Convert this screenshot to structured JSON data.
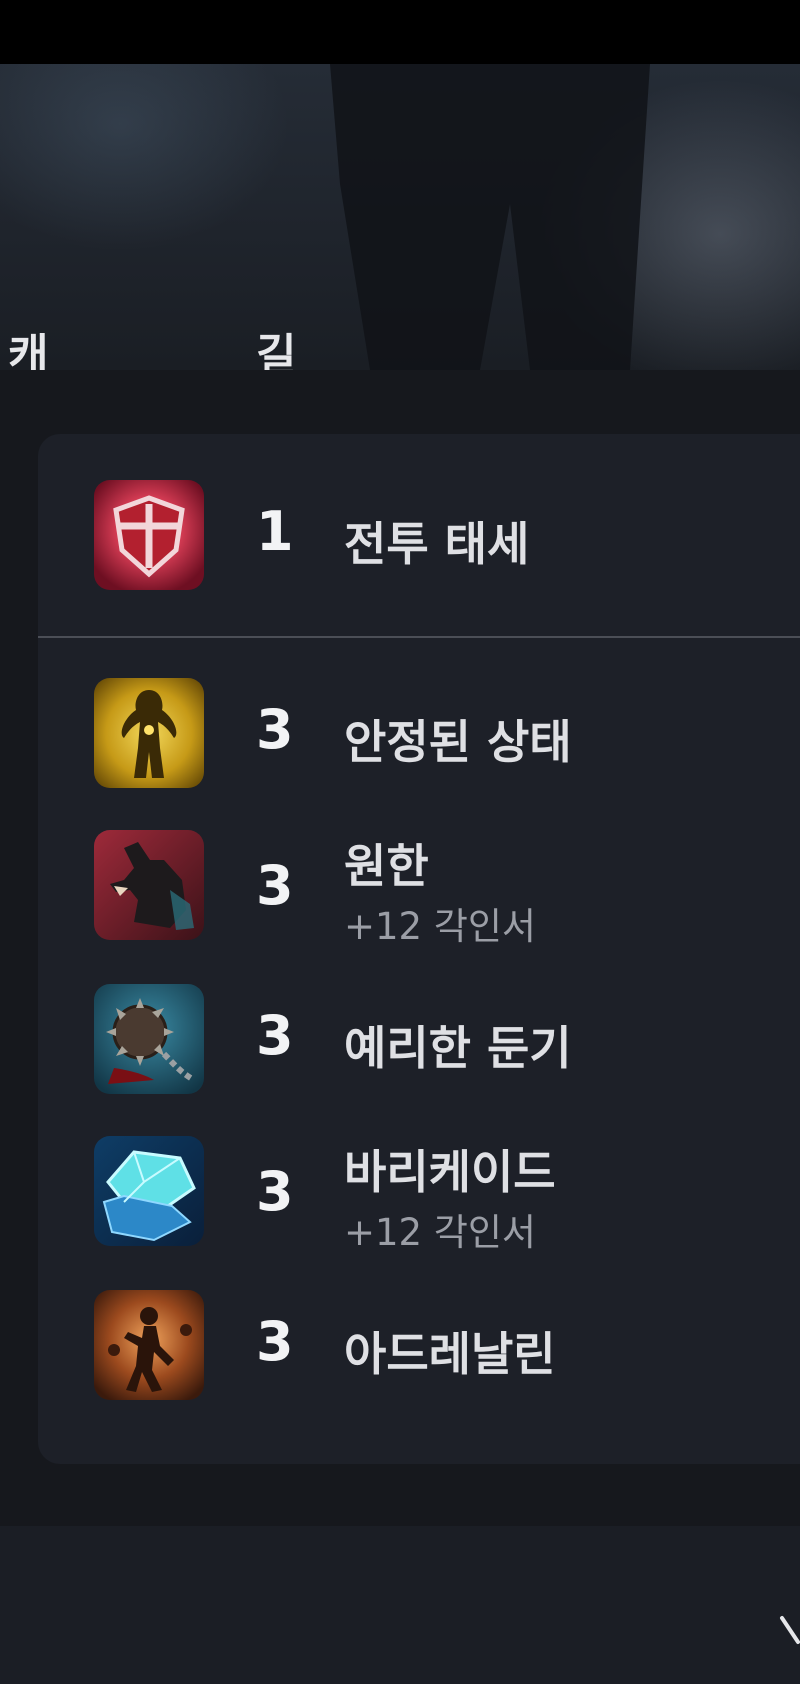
{
  "nav": {
    "tabs": [
      {
        "label": "캐릭터"
      },
      {
        "label": "길드"
      }
    ]
  },
  "skills": [
    {
      "level": "1",
      "name": "전투 태세",
      "icon": "red-shield-icon"
    },
    {
      "level": "3",
      "name": "안정된 상태",
      "icon": "golden-figure-icon"
    },
    {
      "level": "3",
      "name": "원한",
      "sub": "+12 각인서",
      "icon": "werewolf-icon"
    },
    {
      "level": "3",
      "name": "예리한 둔기",
      "icon": "spiked-mace-icon"
    },
    {
      "level": "3",
      "name": "바리케이드",
      "sub": "+12 각인서",
      "icon": "ice-crystal-icon"
    },
    {
      "level": "3",
      "name": "아드레날린",
      "icon": "running-man-icon"
    }
  ],
  "colors": {
    "background": "#16181d",
    "card": "#1d2028",
    "accent_text": "#dfe0e4"
  }
}
